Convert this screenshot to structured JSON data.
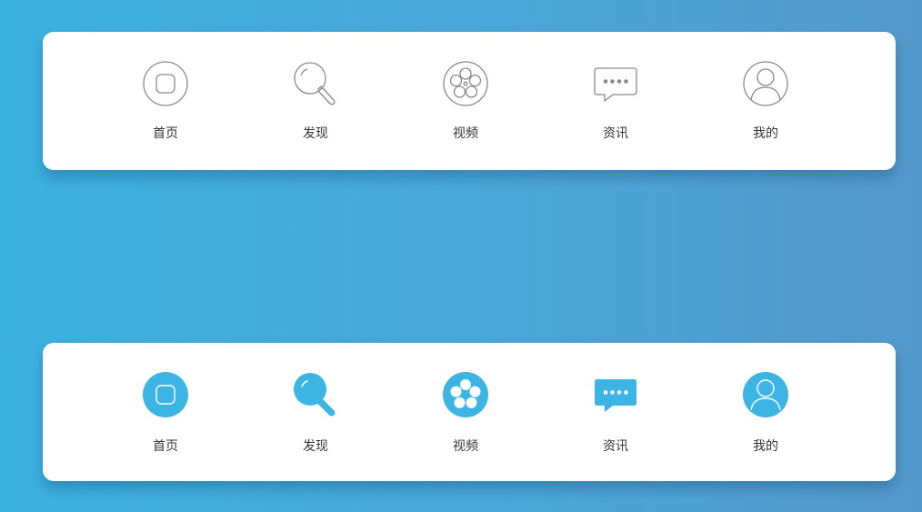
{
  "colors": {
    "outline_stroke": "#8a8a8a",
    "accent": "#3cb4e4",
    "label": "#333333"
  },
  "tabbar_outline": {
    "tabs": [
      {
        "label": "首页",
        "icon": "home-icon"
      },
      {
        "label": "发现",
        "icon": "search-icon"
      },
      {
        "label": "视频",
        "icon": "film-reel-icon"
      },
      {
        "label": "资讯",
        "icon": "message-icon"
      },
      {
        "label": "我的",
        "icon": "user-icon"
      }
    ]
  },
  "tabbar_filled": {
    "tabs": [
      {
        "label": "首页",
        "icon": "home-icon"
      },
      {
        "label": "发现",
        "icon": "search-icon"
      },
      {
        "label": "视频",
        "icon": "film-reel-icon"
      },
      {
        "label": "资讯",
        "icon": "message-icon"
      },
      {
        "label": "我的",
        "icon": "user-icon"
      }
    ]
  }
}
